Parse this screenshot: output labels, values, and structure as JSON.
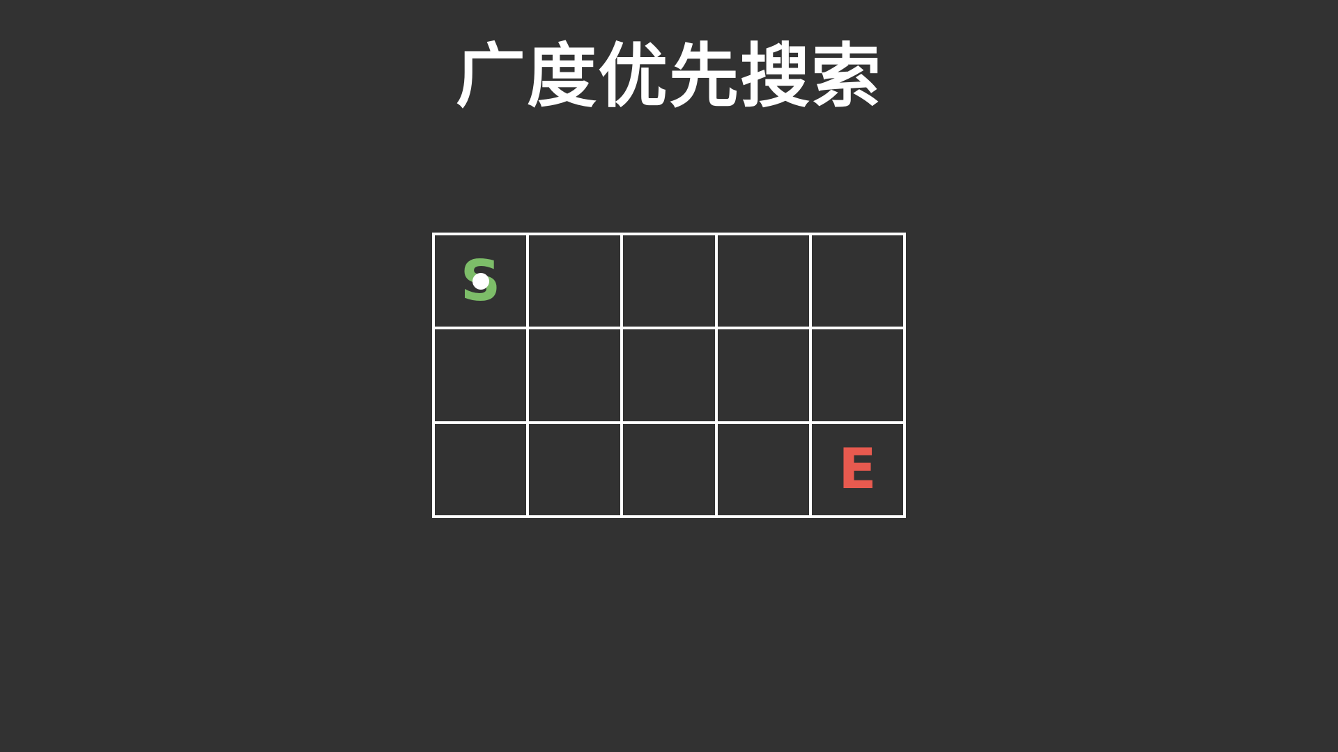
{
  "title": "广度优先搜索",
  "grid": {
    "rows": 3,
    "cols": 5,
    "start": {
      "label": "S",
      "row": 0,
      "col": 0,
      "color": "#7dbd69"
    },
    "end": {
      "label": "E",
      "row": 2,
      "col": 4,
      "color": "#e85a4f"
    },
    "current": {
      "row": 0,
      "col": 0,
      "color": "#ffffff"
    }
  },
  "colors": {
    "background": "#323232",
    "grid_lines": "#ffffff"
  }
}
